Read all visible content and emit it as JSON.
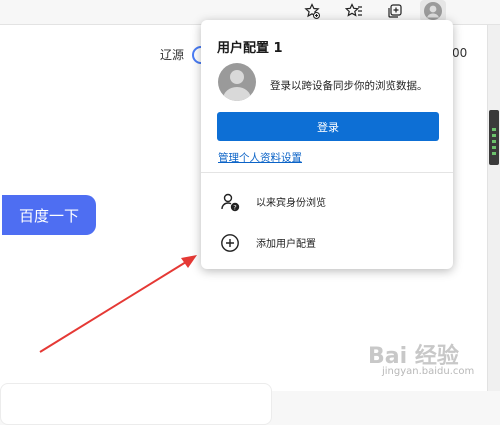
{
  "page": {
    "left_text": "辽源",
    "right_text": "00",
    "search_button_label": "百度一下"
  },
  "toolbar": {
    "icons": [
      "favorites-add-icon",
      "favorites-icon",
      "collections-icon",
      "profile-icon"
    ]
  },
  "profile_panel": {
    "title": "用户配置 1",
    "description": "登录以跨设备同步你的浏览数据。",
    "signin_label": "登录",
    "manage_link": "管理个人资料设置",
    "menu": [
      {
        "label": "以来宾身份浏览",
        "icon": "guest-profile-icon"
      },
      {
        "label": "添加用户配置",
        "icon": "add-profile-icon"
      }
    ]
  },
  "watermark": {
    "text": "Bai 经验",
    "sub": "jingyan.baidu.com"
  },
  "colors": {
    "accent": "#0d6fd5",
    "baidu_blue": "#4e6ef2",
    "annotation_arrow": "#e53935"
  }
}
